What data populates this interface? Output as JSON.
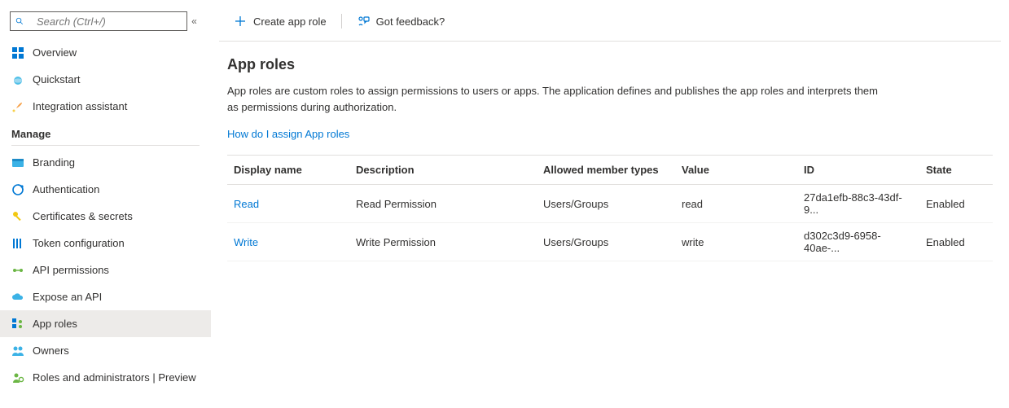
{
  "sidebar": {
    "search_placeholder": "Search (Ctrl+/)",
    "top_items": [
      {
        "label": "Overview"
      },
      {
        "label": "Quickstart"
      },
      {
        "label": "Integration assistant"
      }
    ],
    "manage_heading": "Manage",
    "manage_items": [
      {
        "label": "Branding"
      },
      {
        "label": "Authentication"
      },
      {
        "label": "Certificates & secrets"
      },
      {
        "label": "Token configuration"
      },
      {
        "label": "API permissions"
      },
      {
        "label": "Expose an API"
      },
      {
        "label": "App roles"
      },
      {
        "label": "Owners"
      },
      {
        "label": "Roles and administrators | Preview"
      }
    ]
  },
  "toolbar": {
    "create_label": "Create app role",
    "feedback_label": "Got feedback?"
  },
  "page": {
    "title": "App roles",
    "description": "App roles are custom roles to assign permissions to users or apps. The application defines and publishes the app roles and interprets them as permissions during authorization.",
    "help_link": "How do I assign App roles"
  },
  "table": {
    "headers": {
      "name": "Display name",
      "desc": "Description",
      "types": "Allowed member types",
      "value": "Value",
      "id": "ID",
      "state": "State"
    },
    "rows": [
      {
        "name": "Read",
        "desc": "Read Permission",
        "types": "Users/Groups",
        "value": "read",
        "id": "27da1efb-88c3-43df-9...",
        "state": "Enabled"
      },
      {
        "name": "Write",
        "desc": "Write Permission",
        "types": "Users/Groups",
        "value": "write",
        "id": "d302c3d9-6958-40ae-...",
        "state": "Enabled"
      }
    ]
  }
}
